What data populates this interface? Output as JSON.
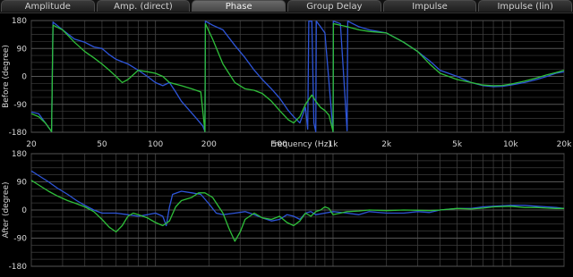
{
  "tabs": [
    {
      "label": "Amplitude",
      "active": false
    },
    {
      "label": "Amp. (direct)",
      "active": false
    },
    {
      "label": "Phase",
      "active": true
    },
    {
      "label": "Group Delay",
      "active": false
    },
    {
      "label": "Impulse",
      "active": false
    },
    {
      "label": "Impulse (lin)",
      "active": false
    }
  ],
  "colors": {
    "grid": "#3c3c3c",
    "background": "#000000",
    "text": "#d8d8d8",
    "blue_trace": "#2e55d8",
    "green_trace": "#2fbf3a"
  },
  "x_axis": {
    "label": "Frequency (Hz)",
    "tick_labels": [
      {
        "f": 20,
        "text": "20"
      },
      {
        "f": 50,
        "text": "50"
      },
      {
        "f": 100,
        "text": "100"
      },
      {
        "f": 200,
        "text": "200"
      },
      {
        "f": 500,
        "text": "500"
      },
      {
        "f": 1000,
        "text": "1k"
      },
      {
        "f": 2000,
        "text": "2k"
      },
      {
        "f": 5000,
        "text": "5k"
      },
      {
        "f": 10000,
        "text": "10k"
      },
      {
        "f": 20000,
        "text": "20k"
      }
    ]
  },
  "chart_data": [
    {
      "type": "line",
      "title": "",
      "ylabel": "Before (degree)",
      "xlabel": "Frequency (Hz)",
      "x_scale": "log",
      "xlim": [
        20,
        20000
      ],
      "ylim": [
        -180,
        180
      ],
      "yticks": [
        180,
        90,
        0,
        -90,
        -180
      ],
      "grid": true,
      "series": [
        {
          "color": "blue",
          "points": [
            [
              20,
              -115
            ],
            [
              22,
              -120
            ],
            [
              24,
              -150
            ],
            [
              26,
              -178
            ],
            [
              26.5,
              175
            ],
            [
              30,
              150
            ],
            [
              35,
              120
            ],
            [
              40,
              110
            ],
            [
              45,
              95
            ],
            [
              50,
              90
            ],
            [
              55,
              70
            ],
            [
              60,
              55
            ],
            [
              70,
              40
            ],
            [
              80,
              20
            ],
            [
              90,
              0
            ],
            [
              100,
              -20
            ],
            [
              110,
              -30
            ],
            [
              120,
              -20
            ],
            [
              130,
              -50
            ],
            [
              140,
              -80
            ],
            [
              150,
              -100
            ],
            [
              170,
              -135
            ],
            [
              185,
              -160
            ],
            [
              190,
              -178
            ],
            [
              191,
              178
            ],
            [
              210,
              165
            ],
            [
              240,
              150
            ],
            [
              280,
              100
            ],
            [
              320,
              60
            ],
            [
              360,
              20
            ],
            [
              400,
              -10
            ],
            [
              450,
              -40
            ],
            [
              500,
              -70
            ],
            [
              560,
              -110
            ],
            [
              600,
              -130
            ],
            [
              650,
              -150
            ],
            [
              700,
              -100
            ],
            [
              720,
              -170
            ],
            [
              730,
              178
            ],
            [
              760,
              178
            ],
            [
              780,
              -150
            ],
            [
              800,
              -178
            ],
            [
              805,
              178
            ],
            [
              850,
              160
            ],
            [
              900,
              140
            ],
            [
              1000,
              -178
            ],
            [
              1005,
              178
            ],
            [
              1100,
              170
            ],
            [
              1200,
              -175
            ],
            [
              1210,
              178
            ],
            [
              1400,
              160
            ],
            [
              1600,
              150
            ],
            [
              2000,
              140
            ],
            [
              2500,
              110
            ],
            [
              3000,
              80
            ],
            [
              3500,
              50
            ],
            [
              4000,
              20
            ],
            [
              5000,
              0
            ],
            [
              6000,
              -20
            ],
            [
              7000,
              -30
            ],
            [
              8000,
              -33
            ],
            [
              9000,
              -32
            ],
            [
              10000,
              -28
            ],
            [
              12000,
              -20
            ],
            [
              14000,
              -10
            ],
            [
              16000,
              0
            ],
            [
              18000,
              10
            ],
            [
              20000,
              15
            ]
          ]
        },
        {
          "color": "green",
          "points": [
            [
              20,
              -120
            ],
            [
              22,
              -130
            ],
            [
              24,
              -150
            ],
            [
              26,
              -178
            ],
            [
              26.5,
              165
            ],
            [
              30,
              150
            ],
            [
              35,
              110
            ],
            [
              40,
              80
            ],
            [
              45,
              60
            ],
            [
              50,
              40
            ],
            [
              55,
              20
            ],
            [
              60,
              0
            ],
            [
              65,
              -20
            ],
            [
              70,
              -10
            ],
            [
              80,
              20
            ],
            [
              90,
              15
            ],
            [
              100,
              10
            ],
            [
              110,
              0
            ],
            [
              120,
              -20
            ],
            [
              140,
              -30
            ],
            [
              160,
              -40
            ],
            [
              180,
              -50
            ],
            [
              190,
              -178
            ],
            [
              191,
              170
            ],
            [
              210,
              120
            ],
            [
              240,
              40
            ],
            [
              280,
              -20
            ],
            [
              320,
              -40
            ],
            [
              360,
              -45
            ],
            [
              400,
              -55
            ],
            [
              450,
              -80
            ],
            [
              500,
              -110
            ],
            [
              560,
              -140
            ],
            [
              600,
              -150
            ],
            [
              650,
              -130
            ],
            [
              700,
              -90
            ],
            [
              760,
              -60
            ],
            [
              800,
              -80
            ],
            [
              850,
              -100
            ],
            [
              900,
              -110
            ],
            [
              950,
              -125
            ],
            [
              1000,
              -178
            ],
            [
              1005,
              170
            ],
            [
              1100,
              165
            ],
            [
              1200,
              160
            ],
            [
              1400,
              150
            ],
            [
              1600,
              145
            ],
            [
              2000,
              140
            ],
            [
              2500,
              110
            ],
            [
              3000,
              80
            ],
            [
              3500,
              40
            ],
            [
              4000,
              10
            ],
            [
              5000,
              -10
            ],
            [
              6000,
              -20
            ],
            [
              7000,
              -28
            ],
            [
              8000,
              -30
            ],
            [
              9000,
              -29
            ],
            [
              10000,
              -25
            ],
            [
              12000,
              -15
            ],
            [
              14000,
              -5
            ],
            [
              16000,
              5
            ],
            [
              18000,
              12
            ],
            [
              20000,
              20
            ]
          ]
        }
      ]
    },
    {
      "type": "line",
      "title": "",
      "ylabel": "After (degree)",
      "xlabel": "",
      "x_scale": "log",
      "xlim": [
        20,
        20000
      ],
      "ylim": [
        -180,
        180
      ],
      "yticks": [
        180,
        90,
        0,
        -90,
        -180
      ],
      "grid": true,
      "series": [
        {
          "color": "blue",
          "points": [
            [
              20,
              125
            ],
            [
              22,
              110
            ],
            [
              25,
              90
            ],
            [
              28,
              70
            ],
            [
              32,
              50
            ],
            [
              36,
              30
            ],
            [
              40,
              15
            ],
            [
              45,
              0
            ],
            [
              50,
              -10
            ],
            [
              60,
              -10
            ],
            [
              70,
              -15
            ],
            [
              80,
              -20
            ],
            [
              90,
              -15
            ],
            [
              100,
              -10
            ],
            [
              110,
              -20
            ],
            [
              115,
              -50
            ],
            [
              120,
              10
            ],
            [
              125,
              50
            ],
            [
              140,
              60
            ],
            [
              160,
              55
            ],
            [
              180,
              50
            ],
            [
              200,
              20
            ],
            [
              220,
              -10
            ],
            [
              240,
              -15
            ],
            [
              280,
              -10
            ],
            [
              320,
              -5
            ],
            [
              360,
              -15
            ],
            [
              400,
              -25
            ],
            [
              450,
              -35
            ],
            [
              500,
              -30
            ],
            [
              550,
              -15
            ],
            [
              600,
              -20
            ],
            [
              650,
              -30
            ],
            [
              700,
              -10
            ],
            [
              750,
              -5
            ],
            [
              800,
              -15
            ],
            [
              900,
              -10
            ],
            [
              1000,
              -5
            ],
            [
              1200,
              -10
            ],
            [
              1400,
              -15
            ],
            [
              1600,
              -5
            ],
            [
              2000,
              -10
            ],
            [
              2500,
              -10
            ],
            [
              3000,
              -5
            ],
            [
              3500,
              -8
            ],
            [
              4000,
              0
            ],
            [
              5000,
              5
            ],
            [
              6000,
              5
            ],
            [
              7000,
              10
            ],
            [
              8000,
              12
            ],
            [
              10000,
              15
            ],
            [
              12000,
              15
            ],
            [
              14000,
              12
            ],
            [
              16000,
              10
            ],
            [
              18000,
              8
            ],
            [
              20000,
              5
            ]
          ]
        },
        {
          "color": "green",
          "points": [
            [
              20,
              95
            ],
            [
              22,
              80
            ],
            [
              25,
              60
            ],
            [
              28,
              45
            ],
            [
              32,
              30
            ],
            [
              36,
              20
            ],
            [
              40,
              10
            ],
            [
              45,
              -5
            ],
            [
              50,
              -30
            ],
            [
              55,
              -55
            ],
            [
              60,
              -70
            ],
            [
              65,
              -50
            ],
            [
              70,
              -20
            ],
            [
              75,
              -10
            ],
            [
              80,
              -15
            ],
            [
              90,
              -25
            ],
            [
              100,
              -40
            ],
            [
              110,
              -50
            ],
            [
              120,
              -35
            ],
            [
              130,
              10
            ],
            [
              140,
              30
            ],
            [
              160,
              40
            ],
            [
              175,
              55
            ],
            [
              190,
              55
            ],
            [
              210,
              40
            ],
            [
              240,
              -10
            ],
            [
              260,
              -60
            ],
            [
              280,
              -100
            ],
            [
              300,
              -70
            ],
            [
              320,
              -30
            ],
            [
              360,
              -10
            ],
            [
              400,
              -25
            ],
            [
              450,
              -30
            ],
            [
              500,
              -20
            ],
            [
              550,
              -40
            ],
            [
              600,
              -50
            ],
            [
              650,
              -35
            ],
            [
              700,
              -10
            ],
            [
              750,
              -20
            ],
            [
              800,
              -5
            ],
            [
              850,
              0
            ],
            [
              900,
              10
            ],
            [
              950,
              5
            ],
            [
              1000,
              -15
            ],
            [
              1100,
              -10
            ],
            [
              1200,
              -5
            ],
            [
              1400,
              -3
            ],
            [
              1600,
              0
            ],
            [
              2000,
              -2
            ],
            [
              2500,
              0
            ],
            [
              3000,
              -1
            ],
            [
              3500,
              -2
            ],
            [
              4000,
              0
            ],
            [
              5000,
              5
            ],
            [
              6000,
              3
            ],
            [
              7000,
              6
            ],
            [
              8000,
              10
            ],
            [
              10000,
              12
            ],
            [
              12000,
              8
            ],
            [
              14000,
              8
            ],
            [
              16000,
              6
            ],
            [
              18000,
              5
            ],
            [
              20000,
              5
            ]
          ]
        }
      ]
    }
  ]
}
